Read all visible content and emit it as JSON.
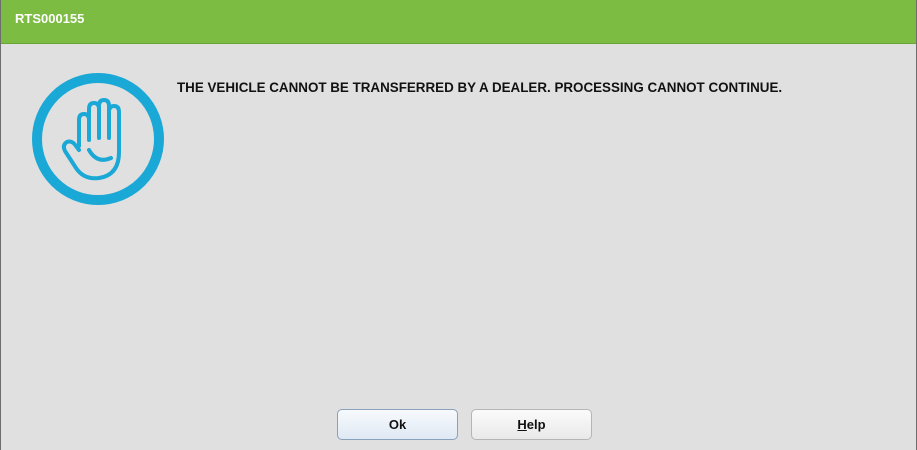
{
  "window": {
    "title": "RTS000155"
  },
  "dialog": {
    "icon": "stop-hand-icon",
    "message": "THE VEHICLE CANNOT BE TRANSFERRED BY A DEALER. PROCESSING CANNOT CONTINUE."
  },
  "buttons": {
    "ok_label": "Ok",
    "help_mnemonic": "H",
    "help_rest": "elp"
  },
  "colors": {
    "titlebar": "#7cbc42",
    "icon_accent": "#1aa8d6",
    "background": "#e0e0e0"
  }
}
